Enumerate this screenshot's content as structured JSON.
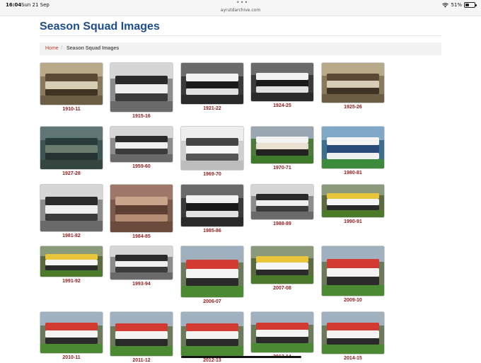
{
  "status_bar": {
    "time": "16:04",
    "date": "Sun 21 Sep",
    "url": "ayrutdarchive.com",
    "battery": "51%",
    "battery_level": 0.51
  },
  "page": {
    "title": "Season Squad Images",
    "breadcrumb": {
      "home": "Home",
      "separator": "/",
      "current": "Season Squad Images"
    }
  },
  "colors": {
    "title": "#1d4d8e",
    "caption": "#8b1c1c",
    "link": "#c0392b"
  },
  "squads": [
    {
      "season": "1910-11",
      "tone": "sepia"
    },
    {
      "season": "1915-16",
      "tone": "bw"
    },
    {
      "season": "1921-22",
      "tone": "bw-dark"
    },
    {
      "season": "1924-25",
      "tone": "bw-dark"
    },
    {
      "season": "1925-26",
      "tone": "sepia"
    },
    {
      "season": "1927-28",
      "tone": "teal-dark"
    },
    {
      "season": "1959-60",
      "tone": "bw"
    },
    {
      "season": "1969-70",
      "tone": "bw-light"
    },
    {
      "season": "1970-71",
      "tone": "color-green"
    },
    {
      "season": "1980-81",
      "tone": "color-blue"
    },
    {
      "season": "1981-82",
      "tone": "bw"
    },
    {
      "season": "1984-85",
      "tone": "color-warm"
    },
    {
      "season": "1985-86",
      "tone": "bw-dark"
    },
    {
      "season": "1988-89",
      "tone": "bw"
    },
    {
      "season": "1990-91",
      "tone": "color-yellow"
    },
    {
      "season": "1991-92",
      "tone": "color-yellow"
    },
    {
      "season": "1993-94",
      "tone": "bw"
    },
    {
      "season": "2006-07",
      "tone": "color-red"
    },
    {
      "season": "2007-08",
      "tone": "color-yellow"
    },
    {
      "season": "2009-10",
      "tone": "color-red"
    },
    {
      "season": "2010-11",
      "tone": "color-red"
    },
    {
      "season": "2011-12",
      "tone": "color-red"
    },
    {
      "season": "2012-13",
      "tone": "color-red"
    },
    {
      "season": "2013-14",
      "tone": "color-red"
    },
    {
      "season": "2014-15",
      "tone": "color-red"
    }
  ]
}
